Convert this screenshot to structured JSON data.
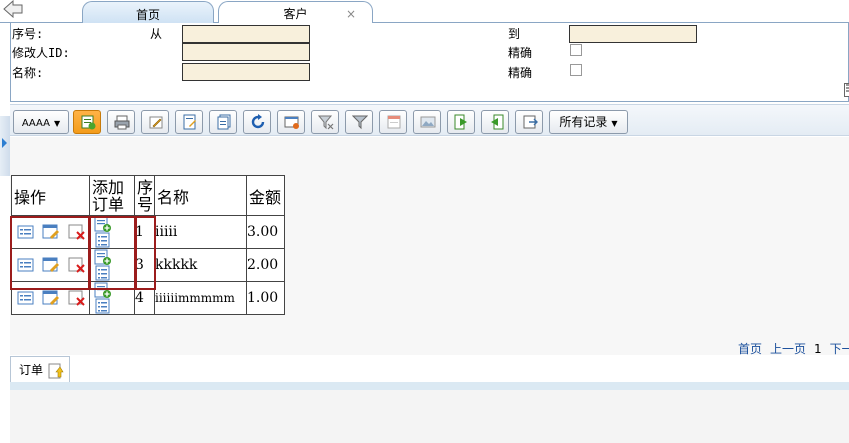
{
  "tabs": [
    {
      "label": "首页"
    },
    {
      "label": "客户",
      "close": "×"
    }
  ],
  "search": {
    "seq_label": "序号:",
    "from_label": "从",
    "to_label": "到",
    "modifier_label": "修改人ID:",
    "name_label": "名称:",
    "exact_label_1": "精确",
    "exact_label_2": "精确",
    "seq_from_value": "",
    "seq_to_value": "",
    "modifier_value": "",
    "name_value": ""
  },
  "toolbar": {
    "view_dropdown": "AAAA",
    "records_dropdown": "所有记录"
  },
  "grid": {
    "headers": {
      "ops": "操作",
      "add_line1": "添加",
      "add_line2": "订单",
      "seq_line1": "序",
      "seq_line2": "号",
      "name": "名称",
      "amount": "金额"
    },
    "rows": [
      {
        "seq": "1",
        "name": "iiiii",
        "amount": "3.00"
      },
      {
        "seq": "3",
        "name": "kkkkk",
        "amount": "2.00"
      },
      {
        "seq": "4",
        "name": "iiiiiimmmmm",
        "amount": "1.00"
      }
    ]
  },
  "pager": {
    "first": "首页",
    "prev": "上一页",
    "current": "1",
    "next": "下一"
  },
  "bottom_tab": {
    "label": "订单"
  },
  "colors": {
    "input_bg": "#f8f0dc",
    "accent_blue": "#2d7ed1",
    "group_border": "#9b1c1c",
    "link": "#1a4f9c"
  }
}
